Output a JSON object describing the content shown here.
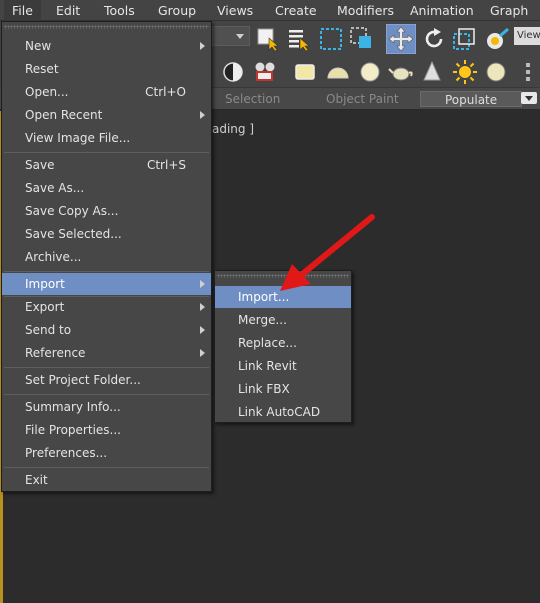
{
  "menubar": [
    "File",
    "Edit",
    "Tools",
    "Group",
    "Views",
    "Create",
    "Modifiers",
    "Animation",
    "Graph Ed"
  ],
  "toolbar": {
    "view_dropdown": "View"
  },
  "ribbon": {
    "tabs": [
      "Selection",
      "Object Paint",
      "Populate"
    ]
  },
  "viewport": {
    "label_fragment": "ading ]"
  },
  "file_menu": {
    "items": {
      "new": "New",
      "reset": "Reset",
      "open": "Open...",
      "open_shortcut": "Ctrl+O",
      "open_recent": "Open Recent",
      "view_image_file": "View Image File...",
      "save": "Save",
      "save_shortcut": "Ctrl+S",
      "save_as": "Save As...",
      "save_copy_as": "Save Copy As...",
      "save_selected": "Save Selected...",
      "archive": "Archive...",
      "import": "Import",
      "export": "Export",
      "send_to": "Send to",
      "reference": "Reference",
      "set_project_folder": "Set Project Folder...",
      "summary_info": "Summary Info...",
      "file_properties": "File Properties...",
      "preferences": "Preferences...",
      "exit": "Exit"
    }
  },
  "import_submenu": {
    "items": [
      "Import...",
      "Merge...",
      "Replace...",
      "Link Revit",
      "Link FBX",
      "Link AutoCAD"
    ]
  },
  "annotation": {
    "arrow_color": "#e01818"
  }
}
